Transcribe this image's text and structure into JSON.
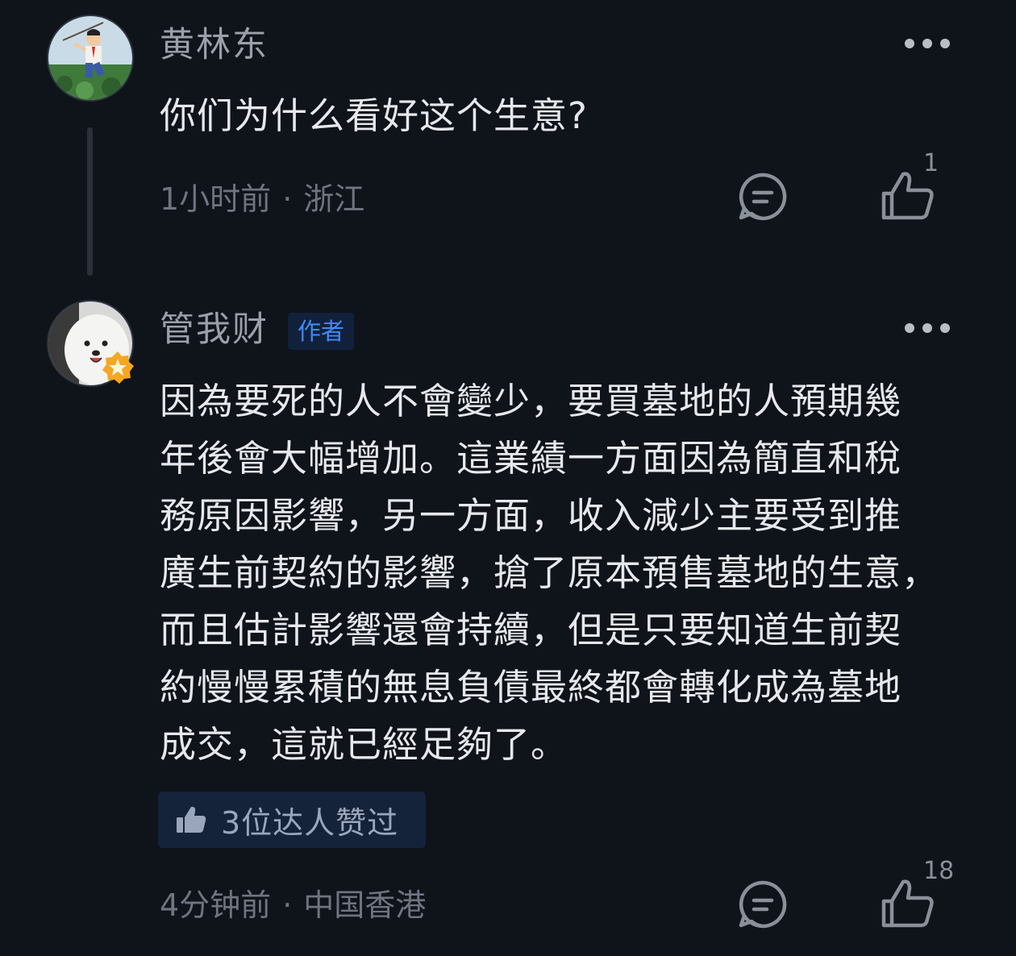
{
  "comments": [
    {
      "username": "黄林东",
      "text": "你们为什么看好这个生意?",
      "time": "1小时前",
      "location": "浙江",
      "likes": "1",
      "avatar": "cartoon-boy-avatar"
    },
    {
      "username": "管我财",
      "badge": "作者",
      "text_lines": [
        "因為要死的人不會變少，要買墓地的人預期幾",
        "年後會大幅增加。這業績一方面因為簡直和稅",
        "務原因影響，另一方面，收入減少主要受到推",
        "廣生前契約的影響，搶了原本預售墓地的生意，",
        "而且估計影響還會持續，但是只要知道生前契",
        "約慢慢累積的無息負債最終都會轉化成為墓地",
        "成交，這就已經足夠了。"
      ],
      "liked_by": "3位达人赞过",
      "time": "4分钟前",
      "location": "中国香港",
      "likes": "18",
      "avatar": "samoyed-dog-avatar"
    }
  ],
  "colors": {
    "background": "#0f131a",
    "text": "#e6e8ec",
    "muted": "#6e7480",
    "author_badge": "#3d8bff",
    "star_badge": "#f5a623"
  },
  "icons": [
    "more-icon",
    "reply-icon",
    "like-icon",
    "star-badge-icon",
    "thumbs-up-icon"
  ]
}
